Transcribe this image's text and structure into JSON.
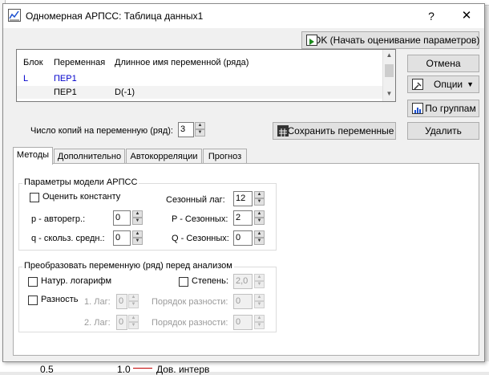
{
  "background": {
    "bottom_left": "0.5",
    "bottom_mid": "1.0",
    "bottom_right": "Дов. интерв"
  },
  "window": {
    "title": "Одномерная АРПСС: Таблица данных1",
    "help": "?",
    "close": "✕"
  },
  "buttons": {
    "ok": "OK (Начать оценивание параметров)",
    "cancel": "Отмена",
    "options": "Опции",
    "by_groups": "По группам",
    "save_vars": "Сохранить переменные",
    "delete": "Удалить"
  },
  "list": {
    "columns": [
      "Блок",
      "Переменная",
      "Длинное имя переменной (ряда)"
    ],
    "rows": [
      {
        "block": "L",
        "var": "ПЕР1",
        "long": ""
      },
      {
        "block": "",
        "var": "ПЕР1",
        "long": "D(-1)"
      }
    ]
  },
  "copies": {
    "label": "Число копий на переменную (ряд):",
    "value": "3"
  },
  "tabs": [
    "Методы",
    "Дополнительно",
    "Автокорреляции",
    "Прогноз"
  ],
  "arima": {
    "title": "Параметры модели АРПСС",
    "estimate_const": "Оценить константу",
    "p_label": "p - авторегр.:",
    "p_value": "0",
    "q_label": "q - скольз. средн.:",
    "q_value": "0",
    "seasonal_lag_label": "Сезонный лаг:",
    "seasonal_lag_value": "12",
    "P_label": "P - Сезонных:",
    "P_value": "2",
    "Q_label": "Q - Сезонных:",
    "Q_value": "0"
  },
  "transform": {
    "title": "Преобразовать переменную (ряд) перед анализом",
    "natural_log": "Натур. логарифм",
    "power": "Степень:",
    "power_value": "2,0",
    "difference": "Разность",
    "lag1_label": "1. Лаг:",
    "lag1_value": "0",
    "order1_label": "Порядок разности:",
    "order1_value": "0",
    "lag2_label": "2. Лаг:",
    "lag2_value": "0",
    "order2_label": "Порядок разности:",
    "order2_value": "0"
  },
  "colors": {
    "blue_text": "#0000cc",
    "selected_row": "#f3f3f3"
  }
}
